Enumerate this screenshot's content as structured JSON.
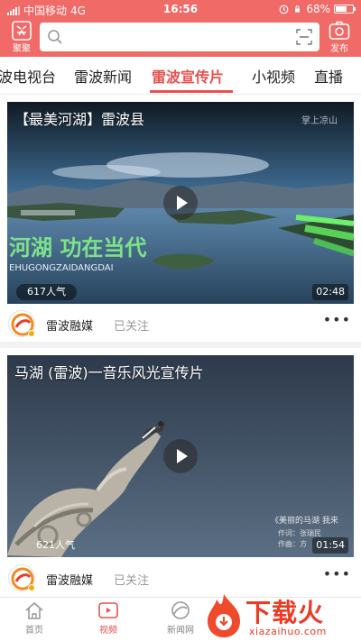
{
  "status_bar": {
    "carrier": "中国移动",
    "network": "4G",
    "time": "16:56",
    "battery": "68%",
    "battery_level": 0.68
  },
  "header": {
    "left_tool_label": "聚聚",
    "publish_label": "发布",
    "search_placeholder": "",
    "accent_color": "#f06a67"
  },
  "tabs": [
    {
      "label": "波电视台",
      "active": false
    },
    {
      "label": "雷波新闻",
      "active": false
    },
    {
      "label": "雷波宣传片",
      "active": true
    },
    {
      "label": "小视频",
      "active": false
    },
    {
      "label": "直播",
      "active": false
    }
  ],
  "feed": [
    {
      "title": "【最美河湖】雷波县",
      "views": "617人气",
      "duration": "02:48",
      "author": "雷波融媒",
      "follow_status": "已关注",
      "overlay_title": "河湖  功在当代",
      "overlay_pinyin": "EHUGONGZAIDANGDAI",
      "overlay_logo": "掌上凉山"
    },
    {
      "title": "马湖 (雷波)一音乐风光宣传片",
      "views": "621人气",
      "duration": "01:54",
      "author": "雷波融媒",
      "follow_status": "已关注",
      "overlay_song": "《美丽的马湖  我来",
      "overlay_lyricist": "作词：张瑞民",
      "overlay_composer": "作曲：方"
    }
  ],
  "bottom_nav": [
    {
      "label": "首页",
      "icon": "home-icon",
      "active": false
    },
    {
      "label": "视频",
      "icon": "video-icon",
      "active": true
    },
    {
      "label": "新闻网",
      "icon": "globe-icon",
      "active": false
    }
  ],
  "watermark": {
    "text": "下载火",
    "sub": "xiazaihuo.com"
  }
}
